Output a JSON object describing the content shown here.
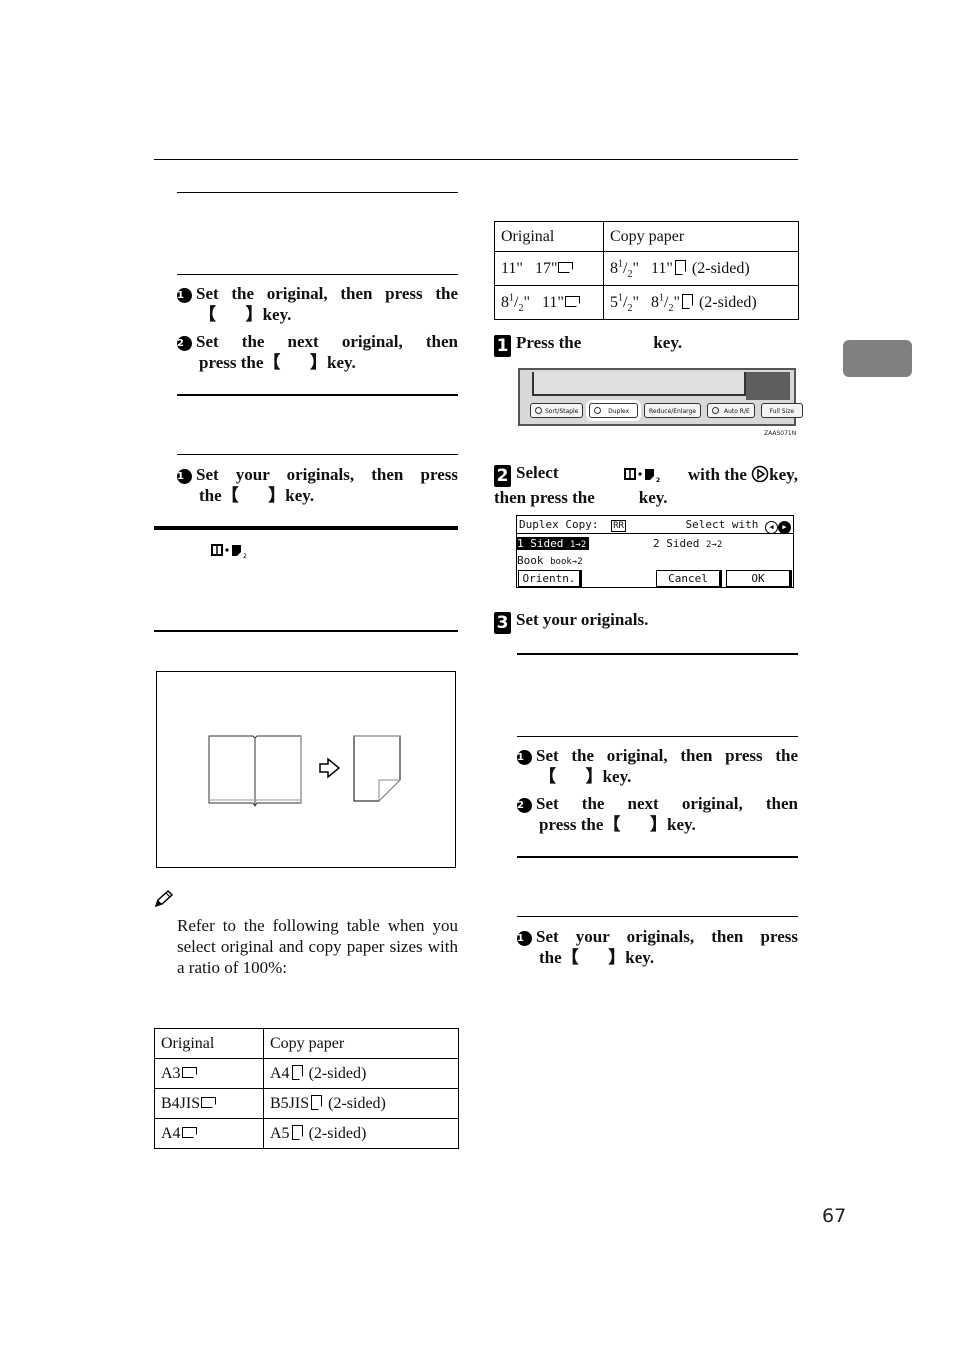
{
  "page": {
    "number": "67",
    "thumb_tab_color": "#808080"
  },
  "left": {
    "section_a": {
      "steps": [
        {
          "num": "1",
          "text": "Set the original, then press the",
          "key_suffix": "key."
        },
        {
          "num": "2",
          "text_line1": "Set the next original, then",
          "text_line2_prefix": "press the",
          "key_suffix": "key."
        }
      ]
    },
    "section_b": {
      "steps": [
        {
          "num": "1",
          "text": "Set your originals, then press",
          "text_line2_prefix": "the",
          "key_suffix": "key."
        }
      ]
    },
    "book_icon_label": "book-to-2-sided-icon",
    "note": {
      "icon": "pencil-icon",
      "text": "Refer to the following table when you select original and copy paper sizes with a ratio of 100%:"
    },
    "table": {
      "headers": [
        "Original",
        "Copy paper"
      ],
      "rows": [
        {
          "original": "A3",
          "original_orient": "landscape",
          "copy": "A4",
          "copy_orient": "portrait",
          "copy_note": "(2-sided)"
        },
        {
          "original": "B4JIS",
          "original_orient": "landscape",
          "copy": "B5JIS",
          "copy_orient": "portrait",
          "copy_note": "(2-sided)"
        },
        {
          "original": "A4",
          "original_orient": "landscape",
          "copy": "A5",
          "copy_orient": "portrait",
          "copy_note": "(2-sided)"
        }
      ]
    }
  },
  "right": {
    "table": {
      "headers": [
        "Original",
        "Copy paper"
      ],
      "rows": [
        {
          "orig_a": "11\"",
          "orig_b": "17\"",
          "copy_a_whole": "8",
          "copy_a_num": "1",
          "copy_a_den": "2",
          "copy_b": "11\"",
          "copy_note": "(2-sided)"
        },
        {
          "orig_a_whole": "8",
          "orig_a_num": "1",
          "orig_a_den": "2",
          "orig_b": "11\"",
          "copy_a_whole": "5",
          "copy_a_num": "1",
          "copy_a_den": "2",
          "copy_b_whole": "8",
          "copy_b_num": "1",
          "copy_b_den": "2",
          "copy_note": "(2-sided)"
        }
      ]
    },
    "steps": [
      {
        "num": "1",
        "prefix": "Press the",
        "suffix": "key."
      },
      {
        "num": "2",
        "line1_prefix": "Select",
        "line1_middle": "with the",
        "line1_suffix": "key,",
        "line2_prefix": "then press the",
        "line2_suffix": "key."
      },
      {
        "num": "3",
        "text": "Set your originals."
      }
    ],
    "control_panel": {
      "keys": [
        {
          "label": "Sort/Staple",
          "led": true
        },
        {
          "label": "Duplex",
          "led": true,
          "highlighted": true
        },
        {
          "label": "Reduce/Enlarge",
          "led": false
        },
        {
          "label": "Auto R/E",
          "led": true
        },
        {
          "label": "Full Size",
          "led": false
        }
      ],
      "caption": "ZAAS071N"
    },
    "lcd": {
      "title": "Duplex Copy:",
      "title_icons": "RR",
      "hint": "Select with",
      "options": [
        {
          "label": "1 Sided",
          "icon": "1→2",
          "selected": true
        },
        {
          "label": "2 Sided",
          "icon": "2→2",
          "selected": false
        },
        {
          "label": "Book",
          "icon": "book→2",
          "selected": false
        }
      ],
      "buttons": [
        "Orientn.",
        "Cancel",
        "OK"
      ]
    },
    "section_a": {
      "steps": [
        {
          "num": "1",
          "text": "Set the original, then press the",
          "key_suffix": "key."
        },
        {
          "num": "2",
          "text_line1": "Set the next original, then",
          "text_line2_prefix": "press the",
          "key_suffix": "key."
        }
      ]
    },
    "section_b": {
      "steps": [
        {
          "num": "1",
          "text": "Set your originals, then press",
          "text_line2_prefix": "the",
          "key_suffix": "key."
        }
      ]
    }
  }
}
